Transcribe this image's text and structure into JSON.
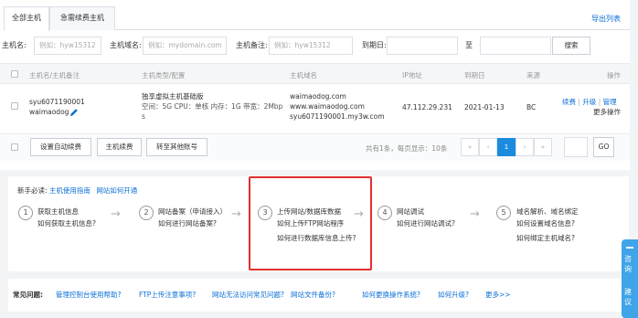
{
  "tabs": [
    {
      "label": "全部主机"
    },
    {
      "label": "急需续费主机"
    }
  ],
  "export_label": "导出列表",
  "filters": {
    "host_name": {
      "label": "主机名:",
      "placeholder": "例如：hyw15312"
    },
    "domain": {
      "label": "主机域名:",
      "placeholder": "例如：mydomain.com"
    },
    "note": {
      "label": "主机备注:",
      "placeholder": "例如：hyw15312"
    },
    "expire": {
      "label": "到期日:",
      "separator": "至"
    },
    "search_label": "搜索"
  },
  "table": {
    "headers": [
      "主机名/主机备注",
      "主机类型/配置",
      "主机域名",
      "IP地址",
      "到期日",
      "来源",
      "操作"
    ],
    "row": {
      "host_name": "syu6071190001",
      "host_note": "waimaodog",
      "type": "独享虚拟主机基础版",
      "config_line1": "空间：5G CPU：单核 内存：1G 带宽：2Mbp",
      "config_line2": "s",
      "domain1": "waimaodog.com",
      "domain2": "www.waimaodog.com",
      "domain3": "syu6071190001.my3w.com",
      "ip": "47.112.29.231",
      "expire": "2021-01-13",
      "source": "BC",
      "op_renew": "续费",
      "op_sep1": "|",
      "op_upgrade": "升级",
      "op_sep2": "|",
      "op_manage": "管理",
      "op_more": "更多操作"
    }
  },
  "footer": {
    "auto_renew": "设置自动续费",
    "renew": "主机续费",
    "transfer": "转至其他账号",
    "summary": "共有1条，每页显示：10条",
    "pager": [
      "«",
      "‹",
      "1",
      "›",
      "»"
    ],
    "go_label": "GO"
  },
  "guide": {
    "intro": "新手必读:",
    "intro_links": [
      "主机使用指南",
      "网站如何开通"
    ],
    "steps": [
      {
        "num": "1",
        "title": "获取主机信息",
        "links": [
          "如何获取主机信息?"
        ]
      },
      {
        "num": "2",
        "title": "网站备案（申请接入）",
        "links": [
          "如何进行网站备案?"
        ]
      },
      {
        "num": "3",
        "title": "上传网站/数据库数据",
        "links": [
          "如何上传FTP网站程序",
          "如何进行数据库信息上传?"
        ]
      },
      {
        "num": "4",
        "title": "网站调试",
        "links": [
          "如何进行网站调试?"
        ]
      },
      {
        "num": "5",
        "title": "域名解析、域名绑定",
        "links": [
          "如何设置域名信息?",
          "如何绑定主机域名?"
        ]
      }
    ]
  },
  "faq": {
    "label": "常见问题:",
    "links": [
      "管理控制台使用帮助?",
      "FTP上传注意事项?",
      "网站无法访问常见问题?",
      "网站文件备份?",
      "如何更换操作系统?",
      "如何升级?",
      "更多>>"
    ]
  },
  "side_tab": {
    "label1": "咨询",
    "label2": "建议"
  },
  "colors": {
    "link": "#0a6fd6",
    "highlight_box": "#e0302f",
    "active_page": "#1a8cde",
    "side_tab": "#3fa4e8"
  }
}
